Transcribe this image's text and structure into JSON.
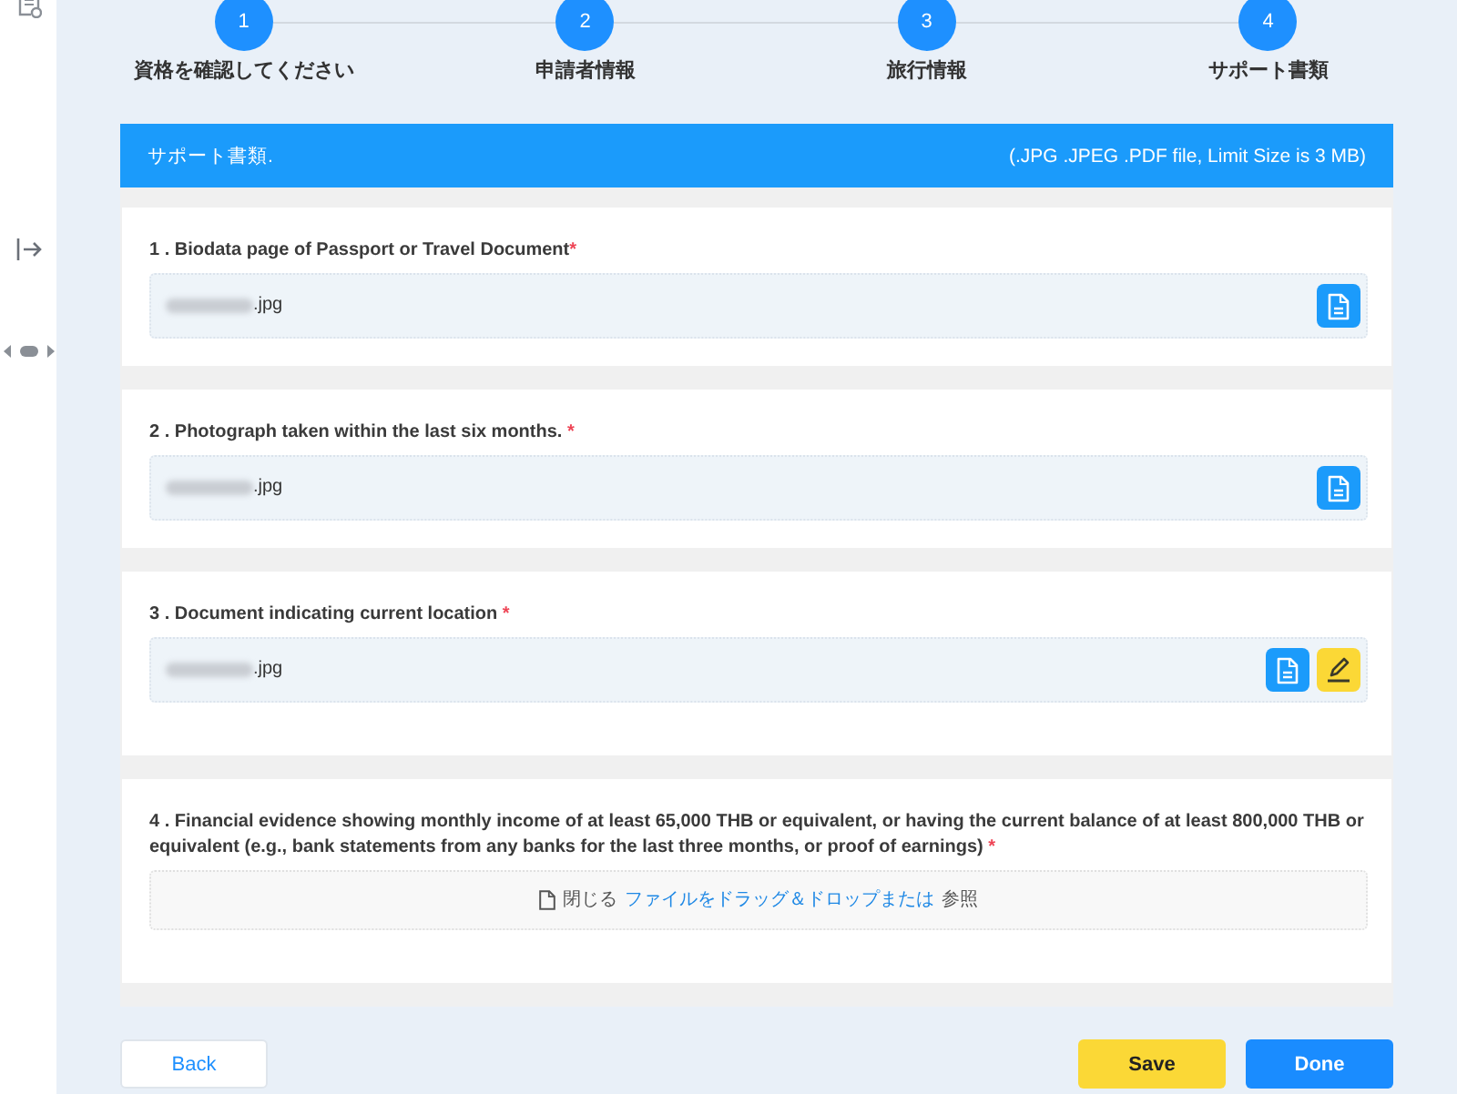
{
  "steps": [
    {
      "number": "1",
      "label": "資格を確認してください"
    },
    {
      "number": "2",
      "label": "申請者情報"
    },
    {
      "number": "3",
      "label": "旅行情報"
    },
    {
      "number": "4",
      "label": "サポート書類"
    }
  ],
  "panel": {
    "title": "サポート書類.",
    "note": "(.JPG .JPEG .PDF file, Limit Size is 3 MB)",
    "sections": [
      {
        "kind": "file",
        "label": "1 . Biodata page of Passport or Travel Document",
        "required_mark": "*",
        "file": {
          "name": ".jpg",
          "blurred": true
        },
        "actions": [
          {
            "kind": "view"
          }
        ]
      },
      {
        "kind": "file",
        "label": "2 . Photograph taken within the last six months. ",
        "required_mark": "*",
        "file": {
          "name": ".jpg",
          "blurred": true
        },
        "actions": [
          {
            "kind": "view"
          }
        ]
      },
      {
        "kind": "file",
        "label": "3 . Document indicating current location ",
        "required_mark": "*",
        "file": {
          "name": ".jpg",
          "blurred": true
        },
        "actions": [
          {
            "kind": "view"
          },
          {
            "kind": "edit"
          }
        ]
      },
      {
        "kind": "dropzone",
        "label": "4 . Financial evidence showing monthly income of at least 65,000 THB or equivalent, or having the current balance of at least 800,000 THB or equivalent (e.g., bank statements from any banks for the last three months, or proof of earnings) ",
        "required_mark": "*",
        "dropzone": {
          "close": "閉じる",
          "hint": "ファイルをドラッグ＆ドロップまたは",
          "browse": "参照"
        }
      }
    ]
  },
  "buttons": [
    {
      "kind": "secondary",
      "label": "Back"
    },
    {
      "kind": "save",
      "label": "Save"
    },
    {
      "kind": "primary",
      "label": "Done"
    }
  ]
}
